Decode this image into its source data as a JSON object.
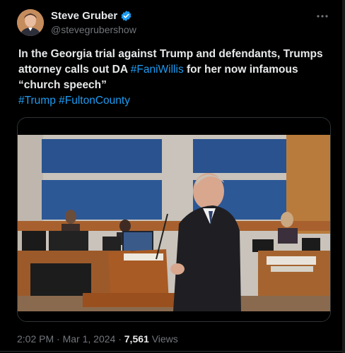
{
  "author": {
    "display_name": "Steve Gruber",
    "handle": "@stevegrubershow",
    "verified": true
  },
  "tweet": {
    "text_main": "In the Georgia trial against Trump and defendants, Trumps attorney calls out DA ",
    "mention_tag": "#FaniWillis",
    "text_tail": " for her now infamous “church speech”",
    "tags": [
      "#Trump",
      "#FultonCounty"
    ]
  },
  "meta": {
    "time": "2:02 PM",
    "sep1": " · ",
    "date": "Mar 1, 2024",
    "sep2": " · ",
    "views_count": "7,561",
    "views_label": " Views"
  },
  "colors": {
    "accent": "#1d9bf0",
    "text": "#e7e9ea",
    "muted": "#71767b",
    "border": "#2f3336",
    "background": "#000000"
  },
  "icons": {
    "verified": "verified-badge-icon",
    "more": "more-dots-icon"
  }
}
